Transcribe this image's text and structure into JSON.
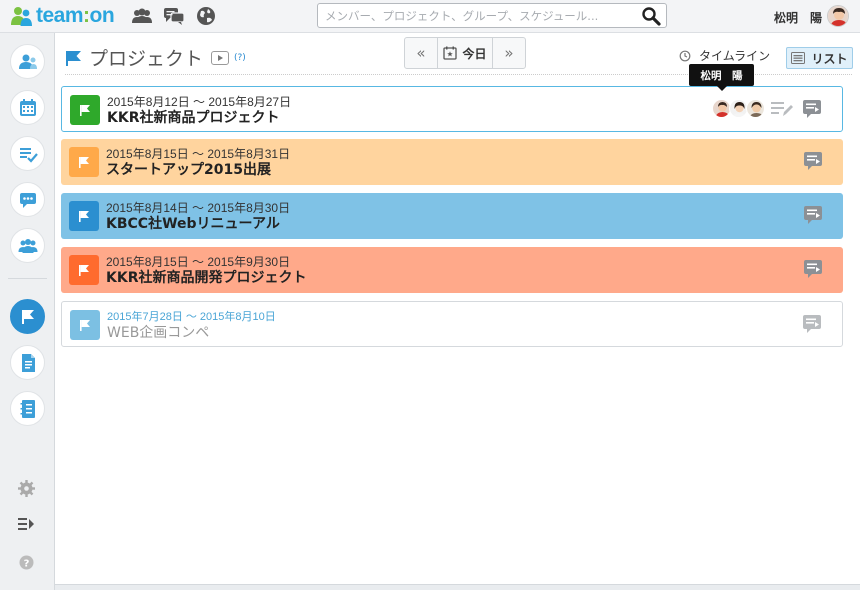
{
  "app": {
    "logo_main": "team",
    "logo_colon": ":",
    "logo_end": "on"
  },
  "header": {
    "search_placeholder": "メンバー、プロジェクト、グループ、スケジュール...",
    "username": "松明　陽"
  },
  "page": {
    "title": "プロジェクト",
    "help": "(?)"
  },
  "nav": {
    "prev": "«",
    "today": "今日",
    "next": "»"
  },
  "views": {
    "timeline": "タイムライン",
    "list": "リスト"
  },
  "tooltip": "松明　陽",
  "projects": [
    {
      "date": "2015年8月12日 ～ 2015年8月27日",
      "name": "KKR社新商品プロジェクト",
      "color": "#2fa92b",
      "bg": "#ffffff"
    },
    {
      "date": "2015年8月15日 ～ 2015年8月31日",
      "name": "スタートアップ2015出展",
      "color": "#ffa949",
      "bg": "#ffd49e"
    },
    {
      "date": "2015年8月14日 ～ 2015年8月30日",
      "name": "KBCC社Webリニューアル",
      "color": "#2b8fd0",
      "bg": "#7fc2e6"
    },
    {
      "date": "2015年8月15日 ～ 2015年9月30日",
      "name": "KKR社新商品開発プロジェクト",
      "color": "#ff6b2e",
      "bg": "#ffa98a"
    },
    {
      "date": "2015年7月28日 ～ 2015年8月10日",
      "name": "WEB企画コンペ",
      "color": "#7cc0e3",
      "bg": "#ffffff"
    }
  ],
  "colors": {
    "brand": "#2aa6de",
    "brand_colon": "#7cc242",
    "active_sidebar": "#2b8fd0",
    "list_view_bg": "#e0f0fa"
  }
}
